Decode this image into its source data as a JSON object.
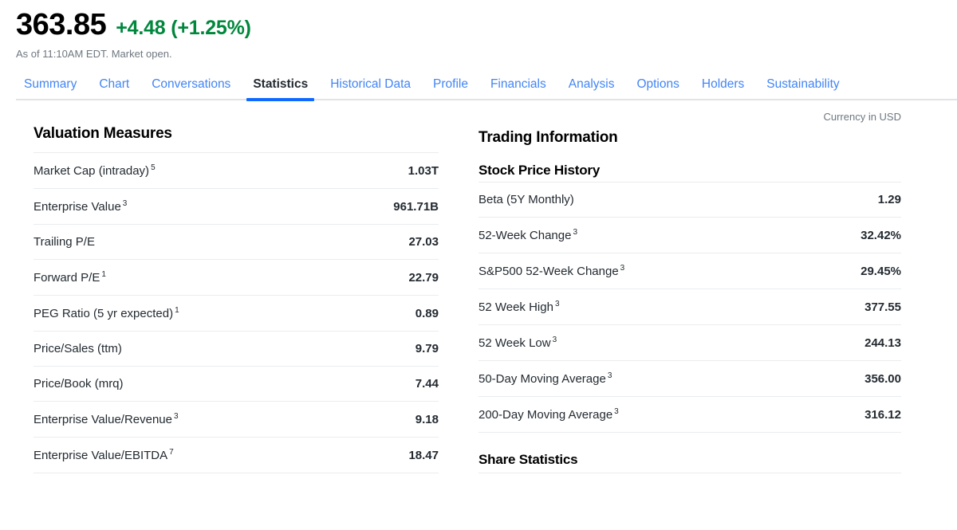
{
  "quote": {
    "price": "363.85",
    "change": "+4.48 (+1.25%)",
    "change_color": "#00873c",
    "as_of": "As of 11:10AM EDT. Market open."
  },
  "tabs": [
    {
      "label": "Summary",
      "active": false
    },
    {
      "label": "Chart",
      "active": false
    },
    {
      "label": "Conversations",
      "active": false
    },
    {
      "label": "Statistics",
      "active": true
    },
    {
      "label": "Historical Data",
      "active": false
    },
    {
      "label": "Profile",
      "active": false
    },
    {
      "label": "Financials",
      "active": false
    },
    {
      "label": "Analysis",
      "active": false
    },
    {
      "label": "Options",
      "active": false
    },
    {
      "label": "Holders",
      "active": false
    },
    {
      "label": "Sustainability",
      "active": false
    }
  ],
  "currency_note": "Currency in USD",
  "left": {
    "title": "Valuation Measures",
    "rows": [
      {
        "label": "Market Cap (intraday)",
        "footnote": "5",
        "value": "1.03T"
      },
      {
        "label": "Enterprise Value",
        "footnote": "3",
        "value": "961.71B"
      },
      {
        "label": "Trailing P/E",
        "footnote": "",
        "value": "27.03"
      },
      {
        "label": "Forward P/E",
        "footnote": "1",
        "value": "22.79"
      },
      {
        "label": "PEG Ratio (5 yr expected)",
        "footnote": "1",
        "value": "0.89"
      },
      {
        "label": "Price/Sales (ttm)",
        "footnote": "",
        "value": "9.79"
      },
      {
        "label": "Price/Book (mrq)",
        "footnote": "",
        "value": "7.44"
      },
      {
        "label": "Enterprise Value/Revenue",
        "footnote": "3",
        "value": "9.18"
      },
      {
        "label": "Enterprise Value/EBITDA",
        "footnote": "7",
        "value": "18.47"
      }
    ]
  },
  "right": {
    "title": "Trading Information",
    "subsection_1": {
      "title": "Stock Price History",
      "rows": [
        {
          "label": "Beta (5Y Monthly)",
          "footnote": "",
          "value": "1.29"
        },
        {
          "label": "52-Week Change",
          "footnote": "3",
          "value": "32.42%"
        },
        {
          "label": "S&P500 52-Week Change",
          "footnote": "3",
          "value": "29.45%"
        },
        {
          "label": "52 Week High",
          "footnote": "3",
          "value": "377.55"
        },
        {
          "label": "52 Week Low",
          "footnote": "3",
          "value": "244.13"
        },
        {
          "label": "50-Day Moving Average",
          "footnote": "3",
          "value": "356.00"
        },
        {
          "label": "200-Day Moving Average",
          "footnote": "3",
          "value": "316.12"
        }
      ]
    },
    "subsection_2": {
      "title": "Share Statistics"
    }
  },
  "colors": {
    "link_blue": "#4285f4",
    "active_underline": "#0f69ff",
    "positive_green": "#00873c",
    "muted_gray": "#6e7780",
    "rule_gray": "#e9ecef"
  }
}
